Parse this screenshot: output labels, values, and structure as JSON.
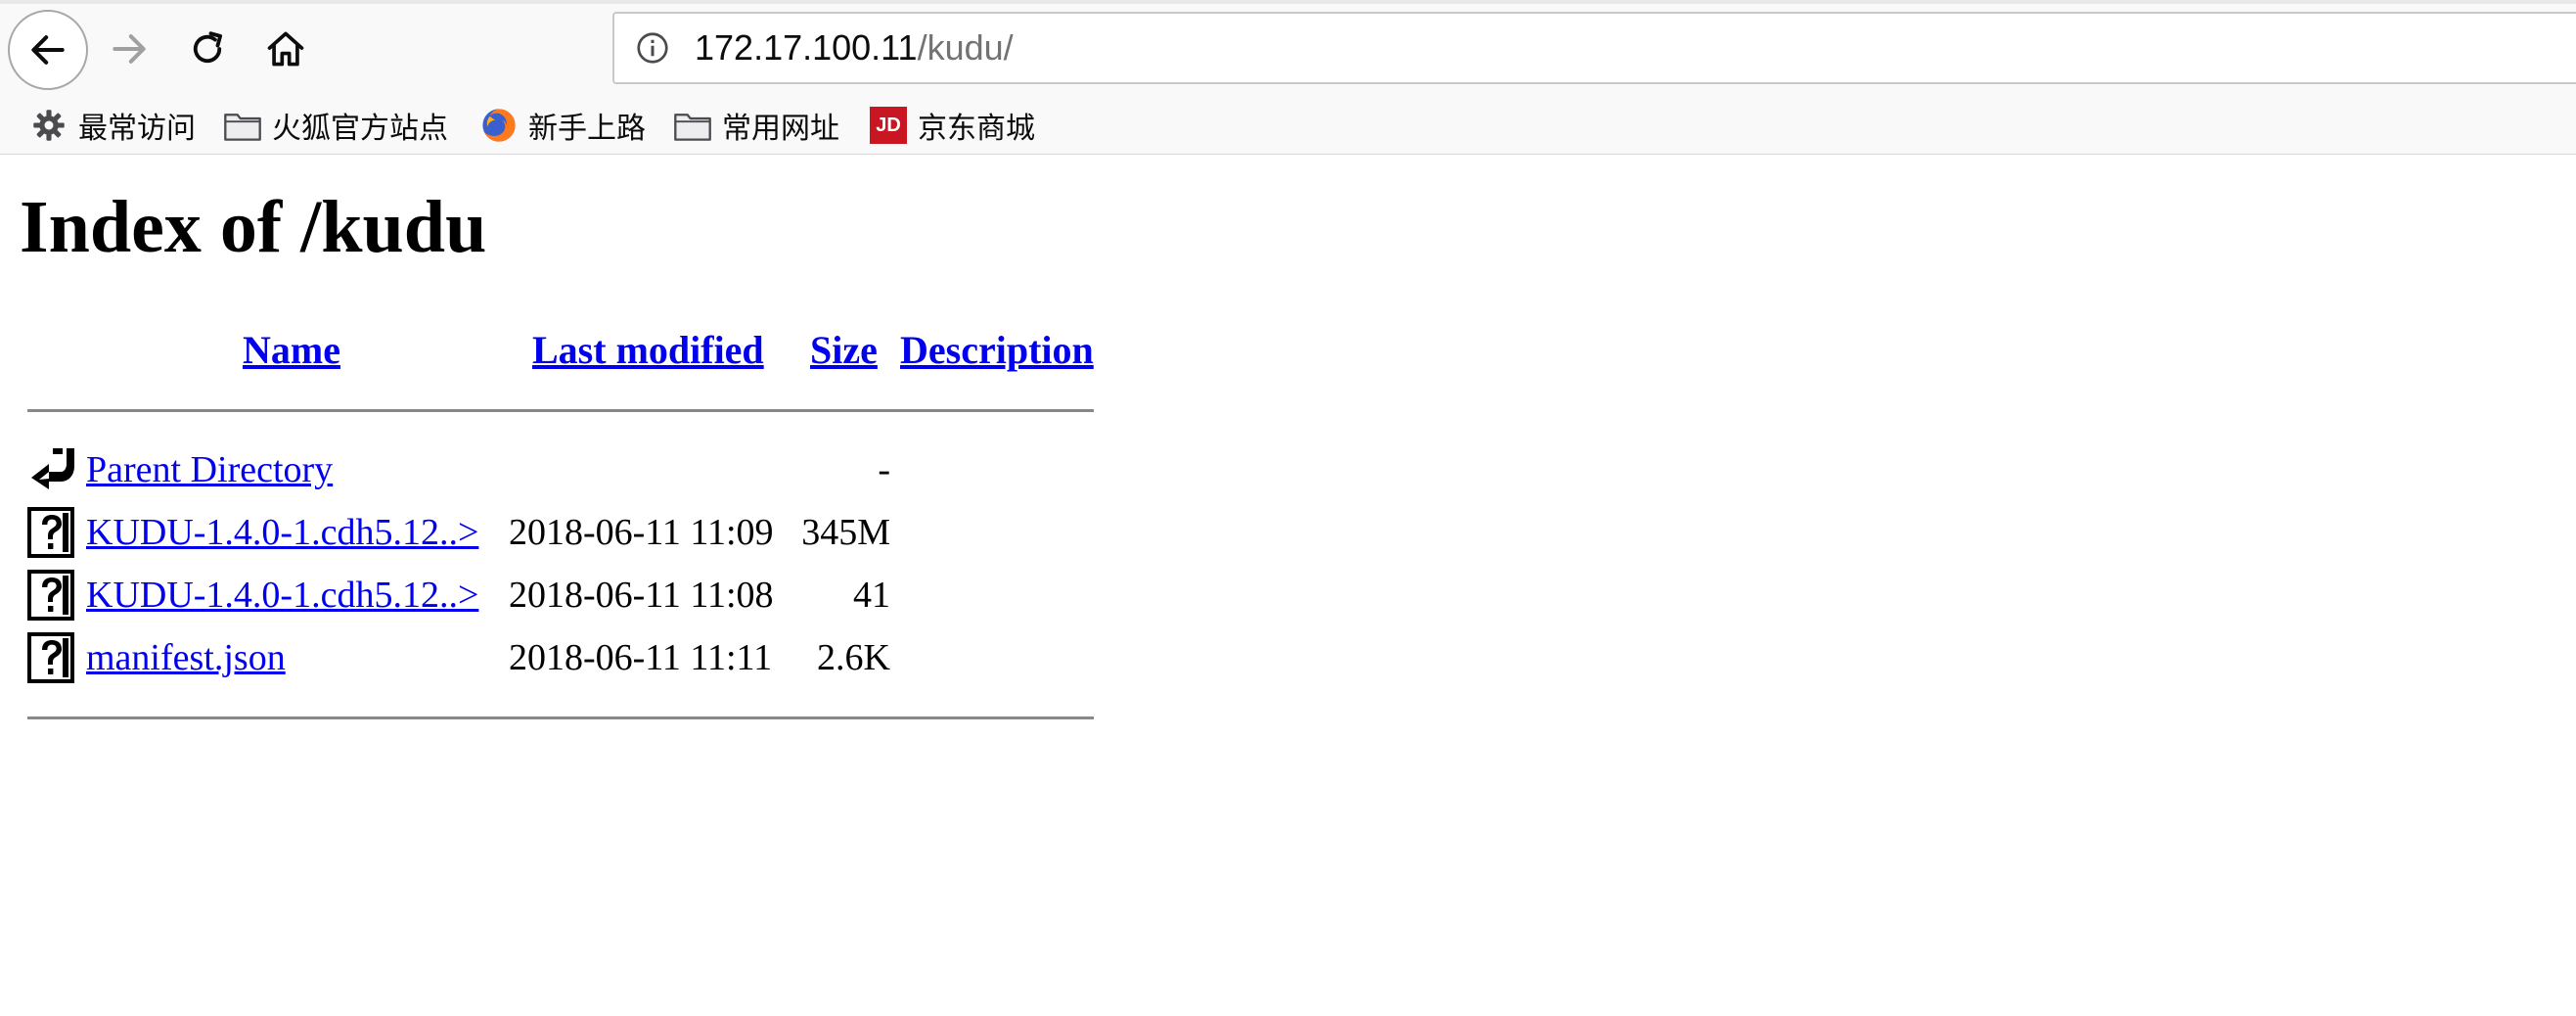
{
  "browser": {
    "url_host": "172.17.100.11",
    "url_path": "/kudu/",
    "bookmarks": [
      {
        "label": "最常访问",
        "icon": "gear-icon"
      },
      {
        "label": "火狐官方站点",
        "icon": "folder-icon"
      },
      {
        "label": "新手上路",
        "icon": "firefox-icon"
      },
      {
        "label": "常用网址",
        "icon": "folder-icon"
      },
      {
        "label": "京东商城",
        "icon": "jd-icon",
        "badge": "JD",
        "badge_color": "#c81623"
      }
    ]
  },
  "page": {
    "title": "Index of /kudu",
    "columns": {
      "name": "Name",
      "last_modified": "Last modified",
      "size": "Size",
      "description": "Description"
    },
    "rows": [
      {
        "name": "Parent Directory",
        "modified": "",
        "size": "-",
        "icon": "back-arrow-icon"
      },
      {
        "name": "KUDU-1.4.0-1.cdh5.12..>",
        "modified": "2018-06-11 11:09",
        "size": "345M",
        "icon": "unknown-file-icon"
      },
      {
        "name": "KUDU-1.4.0-1.cdh5.12..>",
        "modified": "2018-06-11 11:08",
        "size": "41",
        "icon": "unknown-file-icon"
      },
      {
        "name": "manifest.json",
        "modified": "2018-06-11 11:11",
        "size": "2.6K",
        "icon": "unknown-file-icon"
      }
    ]
  },
  "colors": {
    "link": "#0000ee",
    "chrome_bg": "#f9f9fa"
  }
}
